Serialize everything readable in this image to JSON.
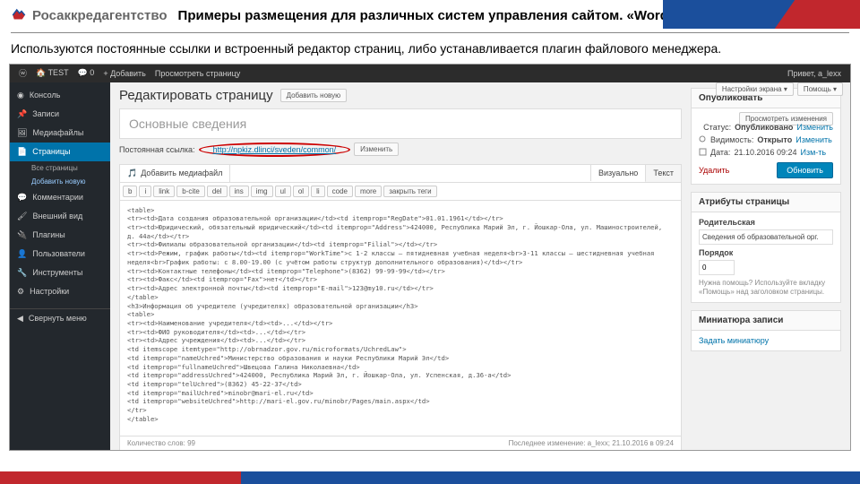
{
  "brand": "Росаккредагентство",
  "slide_title": "Примеры размещения для различных систем управления сайтом. «Word.Press»",
  "description": "Используются постоянные ссылки и встроенный редактор страниц, либо устанавливается плагин файлового менеджера.",
  "wp_top": {
    "site": "TEST",
    "comments": "0",
    "add": "+ Добавить",
    "view": "Просмотреть страницу",
    "hello": "Привет, a_lexx"
  },
  "sidebar": {
    "items": [
      {
        "icon": "dash",
        "label": "Консоль"
      },
      {
        "icon": "pin",
        "label": "Записи"
      },
      {
        "icon": "media",
        "label": "Медиафайлы"
      },
      {
        "icon": "page",
        "label": "Страницы",
        "active": true
      },
      {
        "icon": "comment",
        "label": "Комментарии"
      },
      {
        "icon": "brush",
        "label": "Внешний вид"
      },
      {
        "icon": "plug",
        "label": "Плагины"
      },
      {
        "icon": "user",
        "label": "Пользователи"
      },
      {
        "icon": "tool",
        "label": "Инструменты"
      },
      {
        "icon": "gear",
        "label": "Настройки"
      }
    ],
    "subs": [
      "Все страницы",
      "Добавить новую"
    ],
    "collapse": "Свернуть меню"
  },
  "screen": {
    "opts": "Настройки экрана ▾",
    "help": "Помощь ▾"
  },
  "page": {
    "heading": "Редактировать страницу",
    "add_new": "Добавить новую",
    "title_value": "Основные сведения",
    "perma_label": "Постоянная ссылка:",
    "perma_url": "http://npkiz.dlinci/sveden/common/",
    "perma_edit": "Изменить",
    "add_media": "Добавить медиафайл",
    "tab_visual": "Визуально",
    "tab_text": "Текст",
    "toolbar": [
      "b",
      "i",
      "link",
      "b-cite",
      "del",
      "ins",
      "img",
      "ul",
      "ol",
      "li",
      "code",
      "more",
      "закрыть теги"
    ],
    "html": "<table>\n<tr><td>Дата создания образовательной организации</td><td itemprop=\"RegDate\">01.01.1961</td></tr>\n<tr><td>Юридический, обязательный юридический</td><td itemprop=\"Address\">424000, Республика Марий Эл, г. Йошкар-Ола, ул. Машиностроителей, д. 44а</td></tr>\n<tr><td>Филиалы образовательной организации</td><td itemprop=\"Filial\"></td></tr>\n<tr><td>Режим, график работы</td><td itemprop=\"WorkTime\">с 1-2 классы — пятидневная учебная неделя<br>3-11 классы — шестидневная учебная неделя<br>График работы: с 8.00-19.00 (с учётом работы структур дополнительного образования)</td></tr>\n<tr><td>Контактные телефоны</td><td itemprop=\"Telephone\">(8362) 99-99-99</td></tr>\n<tr><td>Факс</td><td itemprop=\"Fax\">нет</td></tr>\n<tr><td>Адрес электронной почты</td><td itemprop=\"E-mail\">123@my10.ru</td></tr>\n</table>\n<h3>Информация об учредителе (учредителях) образовательной организации</h3>\n<table>\n<tr><td>Наименование учредителя</td><td>...</td></tr>\n<tr><td>ФИО руководителя</td><td>...</td></tr>\n<tr><td>Адрес учреждения</td><td>...</td></tr>\n<td itemscope itemtype=\"http://obrnadzor.gov.ru/microformats/UchredLaw\">\n<td itemprop=\"nameUchred\">Министерство образования и науки Республики Марий Эл</td>\n<td itemprop=\"fullnameUchred\">Швецова Галина Николаевна</td>\n<td itemprop=\"addressUchred\">424000, Республика Марий Эл, г. Йошкар-Ола, ул. Успенская, д.36-а</td>\n<td itemprop=\"telUchred\">(8362) 45-22-37</td>\n<td itemprop=\"mailUchred\">minobr@mari-el.ru</td>\n<td itemprop=\"websiteUchred\">http://mari-el.gov.ru/minobr/Pages/main.aspx</td>\n</tr>\n</table>",
    "wordcount": "Количество слов: 99",
    "lastmod": "Последнее изменение: a_lexx; 21.10.2016 в 09:24"
  },
  "publish": {
    "box": "Опубликовать",
    "preview": "Просмотреть изменения",
    "status_l": "Статус:",
    "status_v": "Опубликовано",
    "edit": "Изменить",
    "vis_l": "Видимость:",
    "vis_v": "Открыто",
    "date_l": "Дата:",
    "date_v": "21.10.2016 09:24",
    "date_e": "Изм-ть",
    "delete": "Удалить",
    "update": "Обновить"
  },
  "attrs": {
    "box": "Атрибуты страницы",
    "parent": "Родительская",
    "parent_v": "Сведения об образовательной орг.",
    "order": "Порядок",
    "order_v": "0",
    "hint": "Нужна помощь? Используйте вкладку «Помощь» над заголовком страницы."
  },
  "thumb": {
    "box": "Миниатюра записи",
    "set": "Задать миниатюру"
  }
}
